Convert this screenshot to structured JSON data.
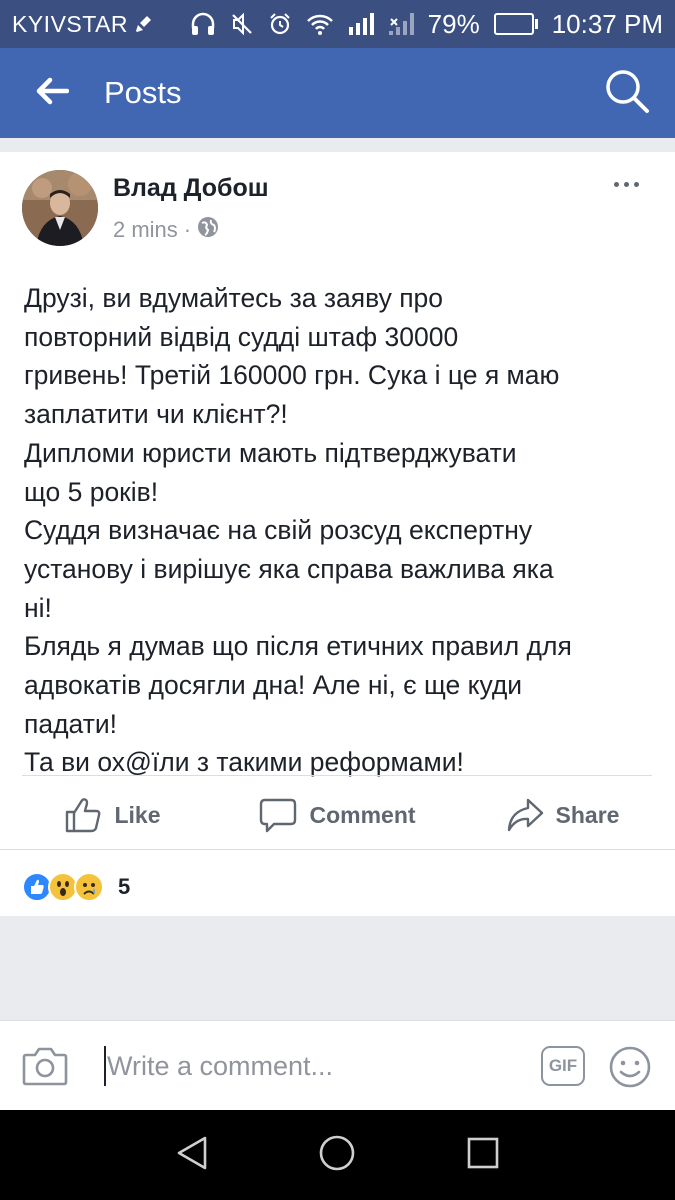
{
  "status_bar": {
    "carrier": "KYIVSTAR",
    "battery": "79%",
    "battery_level": 0.79,
    "time": "10:37 PM"
  },
  "app_bar": {
    "title": "Posts"
  },
  "post": {
    "author": "Влад Добош",
    "time": "2 mins",
    "separator": "·",
    "lines": [
      "Друзі, ви вдумайтесь за заяву про",
      "повторний відвід судді штаф 30000",
      "гривень!  Третій 160000 грн. Сука і це я маю",
      "заплатити чи клієнт?!",
      "Дипломи юристи мають підтверджувати",
      "що 5 років!",
      "Суддя визначає на свій розсуд експертну",
      "установу і вирішує яка справа важлива яка",
      "ні!",
      "Блядь я думав що після етичних правил для",
      "адвокатів досягли дна!  Але ні, є ще куди",
      "падати!",
      "Та ви ох@їли з такими реформами!"
    ],
    "actions": {
      "like": "Like",
      "comment": "Comment",
      "share": "Share"
    },
    "reactions": [
      "like",
      "wow",
      "sad"
    ],
    "reaction_count": "5"
  },
  "comment_bar": {
    "placeholder": "Write a comment...",
    "gif_label": "GIF"
  },
  "icons": {
    "back": "arrow-left-icon",
    "search": "search-icon",
    "camera": "camera-icon",
    "smiley": "smiley-icon",
    "globe": "globe-icon"
  },
  "colors": {
    "brand": "#4267b2",
    "status_bar": "#3b4f80",
    "like_blue": "#2d88ff",
    "reaction_yellow": "#f5c33b"
  }
}
